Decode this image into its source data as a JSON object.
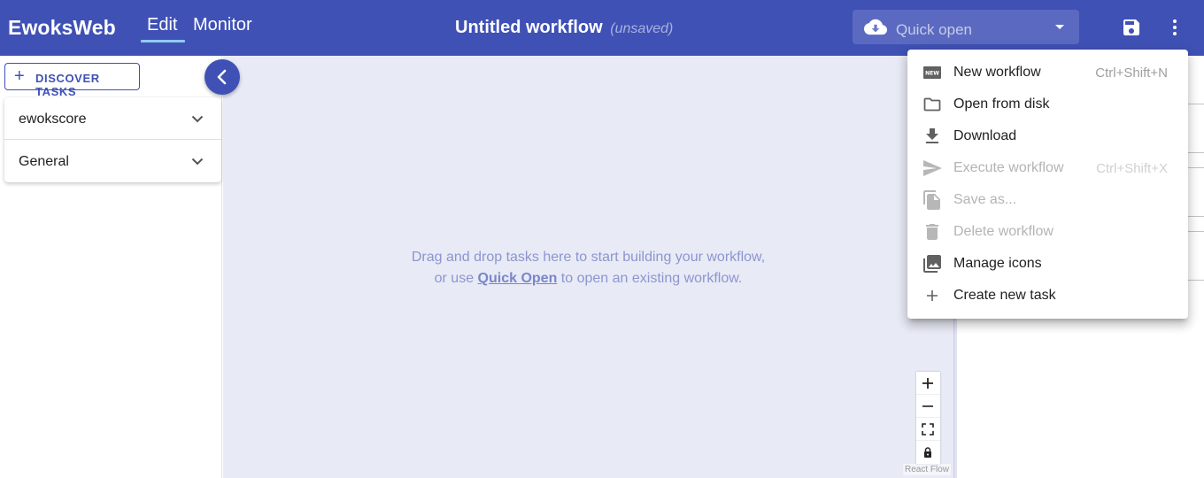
{
  "app": {
    "brand": "EwoksWeb"
  },
  "nav": {
    "tabs": [
      {
        "label": "Edit"
      },
      {
        "label": "Monitor"
      }
    ]
  },
  "workflow": {
    "title": "Untitled workflow",
    "status": "(unsaved)"
  },
  "quick_open": {
    "label": "Quick open",
    "icon": "cloud-download-icon"
  },
  "toolbar": {
    "save_icon": "save-icon",
    "more_icon": "more-vert-icon"
  },
  "sidebar": {
    "discover_label": "DISCOVER TASKS",
    "categories": [
      {
        "label": "ewokscore"
      },
      {
        "label": "General"
      }
    ]
  },
  "canvas": {
    "hint_line1": "Drag and drop tasks here to start building your workflow,",
    "hint_prefix": "or use",
    "hint_link": "Quick Open",
    "hint_suffix": "to open an existing workflow.",
    "attribution": "React Flow"
  },
  "menu": {
    "items": [
      {
        "label": "New workflow",
        "shortcut": "Ctrl+Shift+N",
        "icon": "new-icon",
        "disabled": false
      },
      {
        "label": "Open from disk",
        "shortcut": "",
        "icon": "folder-icon",
        "disabled": false
      },
      {
        "label": "Download",
        "shortcut": "",
        "icon": "download-icon",
        "disabled": false
      },
      {
        "label": "Execute workflow",
        "shortcut": "Ctrl+Shift+X",
        "icon": "send-icon",
        "disabled": true
      },
      {
        "label": "Save as...",
        "shortcut": "",
        "icon": "copy-icon",
        "disabled": true
      },
      {
        "label": "Delete workflow",
        "shortcut": "",
        "icon": "trash-icon",
        "disabled": true
      },
      {
        "label": "Manage icons",
        "shortcut": "",
        "icon": "images-icon",
        "disabled": false
      },
      {
        "label": "Create new task",
        "shortcut": "",
        "icon": "plus-icon",
        "disabled": false
      }
    ]
  },
  "colors": {
    "primary": "#3f51b5",
    "canvas": "#e8eaf6",
    "hint": "#8c96cf"
  }
}
